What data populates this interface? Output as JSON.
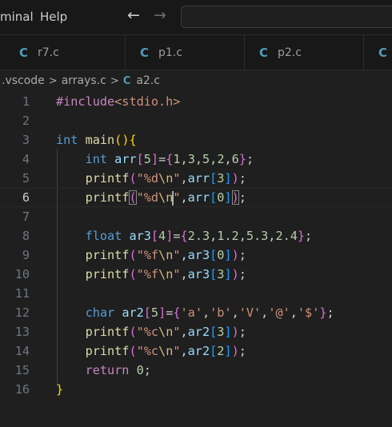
{
  "menu": {
    "items": [
      "minal",
      "Help"
    ]
  },
  "nav": {
    "back_glyph": "←",
    "forward_glyph": "→"
  },
  "tabs": [
    {
      "icon": "C",
      "label": "r7.c"
    },
    {
      "icon": "C",
      "label": "p1.c"
    },
    {
      "icon": "C",
      "label": "p2.c"
    },
    {
      "icon": "C",
      "label": ""
    }
  ],
  "breadcrumb": {
    "folder": ".vscode",
    "file": "arrays.c",
    "icon": "C",
    "current": "a2.c",
    "separator": ">"
  },
  "editor": {
    "active_line": 6,
    "lines": [
      {
        "n": "1",
        "tokens": [
          [
            "ctl",
            "#include"
          ],
          [
            "str",
            "<stdio.h>"
          ]
        ]
      },
      {
        "n": "2",
        "tokens": []
      },
      {
        "n": "3",
        "tokens": [
          [
            "kw",
            "int"
          ],
          [
            "plain",
            " "
          ],
          [
            "fn",
            "main"
          ],
          [
            "br1",
            "()"
          ],
          [
            "br1",
            "{"
          ]
        ]
      },
      {
        "n": "4",
        "tokens": [
          [
            "plain",
            "    "
          ],
          [
            "kw",
            "int"
          ],
          [
            "plain",
            " "
          ],
          [
            "var",
            "arr"
          ],
          [
            "br2",
            "["
          ],
          [
            "num",
            "5"
          ],
          [
            "br2",
            "]"
          ],
          [
            "plain",
            "="
          ],
          [
            "br2",
            "{"
          ],
          [
            "num",
            "1"
          ],
          [
            "plain",
            ","
          ],
          [
            "num",
            "3"
          ],
          [
            "plain",
            ","
          ],
          [
            "num",
            "5"
          ],
          [
            "plain",
            ","
          ],
          [
            "num",
            "2"
          ],
          [
            "plain",
            ","
          ],
          [
            "num",
            "6"
          ],
          [
            "br2",
            "}"
          ],
          [
            "plain",
            ";"
          ]
        ]
      },
      {
        "n": "5",
        "tokens": [
          [
            "plain",
            "    "
          ],
          [
            "fn",
            "printf"
          ],
          [
            "br2",
            "("
          ],
          [
            "str",
            "\"%d"
          ],
          [
            "esc",
            "\\n"
          ],
          [
            "str",
            "\""
          ],
          [
            "plain",
            ","
          ],
          [
            "var",
            "arr"
          ],
          [
            "br3",
            "["
          ],
          [
            "num",
            "3"
          ],
          [
            "br3",
            "]"
          ],
          [
            "br2",
            ")"
          ],
          [
            "plain",
            ";"
          ]
        ]
      },
      {
        "n": "6",
        "tokens": [
          [
            "plain",
            "    "
          ],
          [
            "fn",
            "printf"
          ],
          [
            "br2m",
            "("
          ],
          [
            "str",
            "\"%d"
          ],
          [
            "esc",
            "\\n"
          ],
          [
            "cursor",
            ""
          ],
          [
            "str",
            "\""
          ],
          [
            "plain",
            ","
          ],
          [
            "var",
            "arr"
          ],
          [
            "br3",
            "["
          ],
          [
            "num",
            "0"
          ],
          [
            "br3",
            "]"
          ],
          [
            "br2m",
            ")"
          ],
          [
            "plain",
            ";"
          ]
        ]
      },
      {
        "n": "7",
        "tokens": []
      },
      {
        "n": "8",
        "tokens": [
          [
            "plain",
            "    "
          ],
          [
            "kw",
            "float"
          ],
          [
            "plain",
            " "
          ],
          [
            "var",
            "ar3"
          ],
          [
            "br2",
            "["
          ],
          [
            "num",
            "4"
          ],
          [
            "br2",
            "]"
          ],
          [
            "plain",
            "="
          ],
          [
            "br2",
            "{"
          ],
          [
            "num",
            "2.3"
          ],
          [
            "plain",
            ","
          ],
          [
            "num",
            "1.2"
          ],
          [
            "plain",
            ","
          ],
          [
            "num",
            "5.3"
          ],
          [
            "plain",
            ","
          ],
          [
            "num",
            "2.4"
          ],
          [
            "br2",
            "}"
          ],
          [
            "plain",
            ";"
          ]
        ]
      },
      {
        "n": "9",
        "tokens": [
          [
            "plain",
            "    "
          ],
          [
            "fn",
            "printf"
          ],
          [
            "br2",
            "("
          ],
          [
            "str",
            "\"%f"
          ],
          [
            "esc",
            "\\n"
          ],
          [
            "str",
            "\""
          ],
          [
            "plain",
            ","
          ],
          [
            "var",
            "ar3"
          ],
          [
            "br3",
            "["
          ],
          [
            "num",
            "0"
          ],
          [
            "br3",
            "]"
          ],
          [
            "br2",
            ")"
          ],
          [
            "plain",
            ";"
          ]
        ]
      },
      {
        "n": "10",
        "tokens": [
          [
            "plain",
            "    "
          ],
          [
            "fn",
            "printf"
          ],
          [
            "br2",
            "("
          ],
          [
            "str",
            "\"%f"
          ],
          [
            "esc",
            "\\n"
          ],
          [
            "str",
            "\""
          ],
          [
            "plain",
            ","
          ],
          [
            "var",
            "ar3"
          ],
          [
            "br3",
            "["
          ],
          [
            "num",
            "3"
          ],
          [
            "br3",
            "]"
          ],
          [
            "br2",
            ")"
          ],
          [
            "plain",
            ";"
          ]
        ]
      },
      {
        "n": "11",
        "tokens": []
      },
      {
        "n": "12",
        "tokens": [
          [
            "plain",
            "    "
          ],
          [
            "kw",
            "char"
          ],
          [
            "plain",
            " "
          ],
          [
            "var",
            "ar2"
          ],
          [
            "br2",
            "["
          ],
          [
            "num",
            "5"
          ],
          [
            "br2",
            "]"
          ],
          [
            "plain",
            "="
          ],
          [
            "br2",
            "{"
          ],
          [
            "str",
            "'a'"
          ],
          [
            "plain",
            ","
          ],
          [
            "str",
            "'b'"
          ],
          [
            "plain",
            ","
          ],
          [
            "str",
            "'V'"
          ],
          [
            "plain",
            ","
          ],
          [
            "str",
            "'@'"
          ],
          [
            "plain",
            ","
          ],
          [
            "str",
            "'$'"
          ],
          [
            "br2",
            "}"
          ],
          [
            "plain",
            ";"
          ]
        ]
      },
      {
        "n": "13",
        "tokens": [
          [
            "plain",
            "    "
          ],
          [
            "fn",
            "printf"
          ],
          [
            "br2",
            "("
          ],
          [
            "str",
            "\"%c"
          ],
          [
            "esc",
            "\\n"
          ],
          [
            "str",
            "\""
          ],
          [
            "plain",
            ","
          ],
          [
            "var",
            "ar2"
          ],
          [
            "br3",
            "["
          ],
          [
            "num",
            "3"
          ],
          [
            "br3",
            "]"
          ],
          [
            "br2",
            ")"
          ],
          [
            "plain",
            ";"
          ]
        ]
      },
      {
        "n": "14",
        "tokens": [
          [
            "plain",
            "    "
          ],
          [
            "fn",
            "printf"
          ],
          [
            "br2",
            "("
          ],
          [
            "str",
            "\"%c"
          ],
          [
            "esc",
            "\\n"
          ],
          [
            "str",
            "\""
          ],
          [
            "plain",
            ","
          ],
          [
            "var",
            "ar2"
          ],
          [
            "br3",
            "["
          ],
          [
            "num",
            "2"
          ],
          [
            "br3",
            "]"
          ],
          [
            "br2",
            ")"
          ],
          [
            "plain",
            ";"
          ]
        ]
      },
      {
        "n": "15",
        "tokens": [
          [
            "plain",
            "    "
          ],
          [
            "ctl",
            "return"
          ],
          [
            "plain",
            " "
          ],
          [
            "num",
            "0"
          ],
          [
            "plain",
            ";"
          ]
        ]
      },
      {
        "n": "16",
        "tokens": [
          [
            "br1",
            "}"
          ]
        ]
      }
    ]
  },
  "colors": {
    "background": "#1f1f1f",
    "keyword": "#569cd6",
    "control": "#c586c0",
    "function": "#dcdcaa",
    "variable": "#9cdcfe",
    "string": "#ce9178",
    "number": "#b5cea8",
    "c_icon": "#519aba"
  }
}
